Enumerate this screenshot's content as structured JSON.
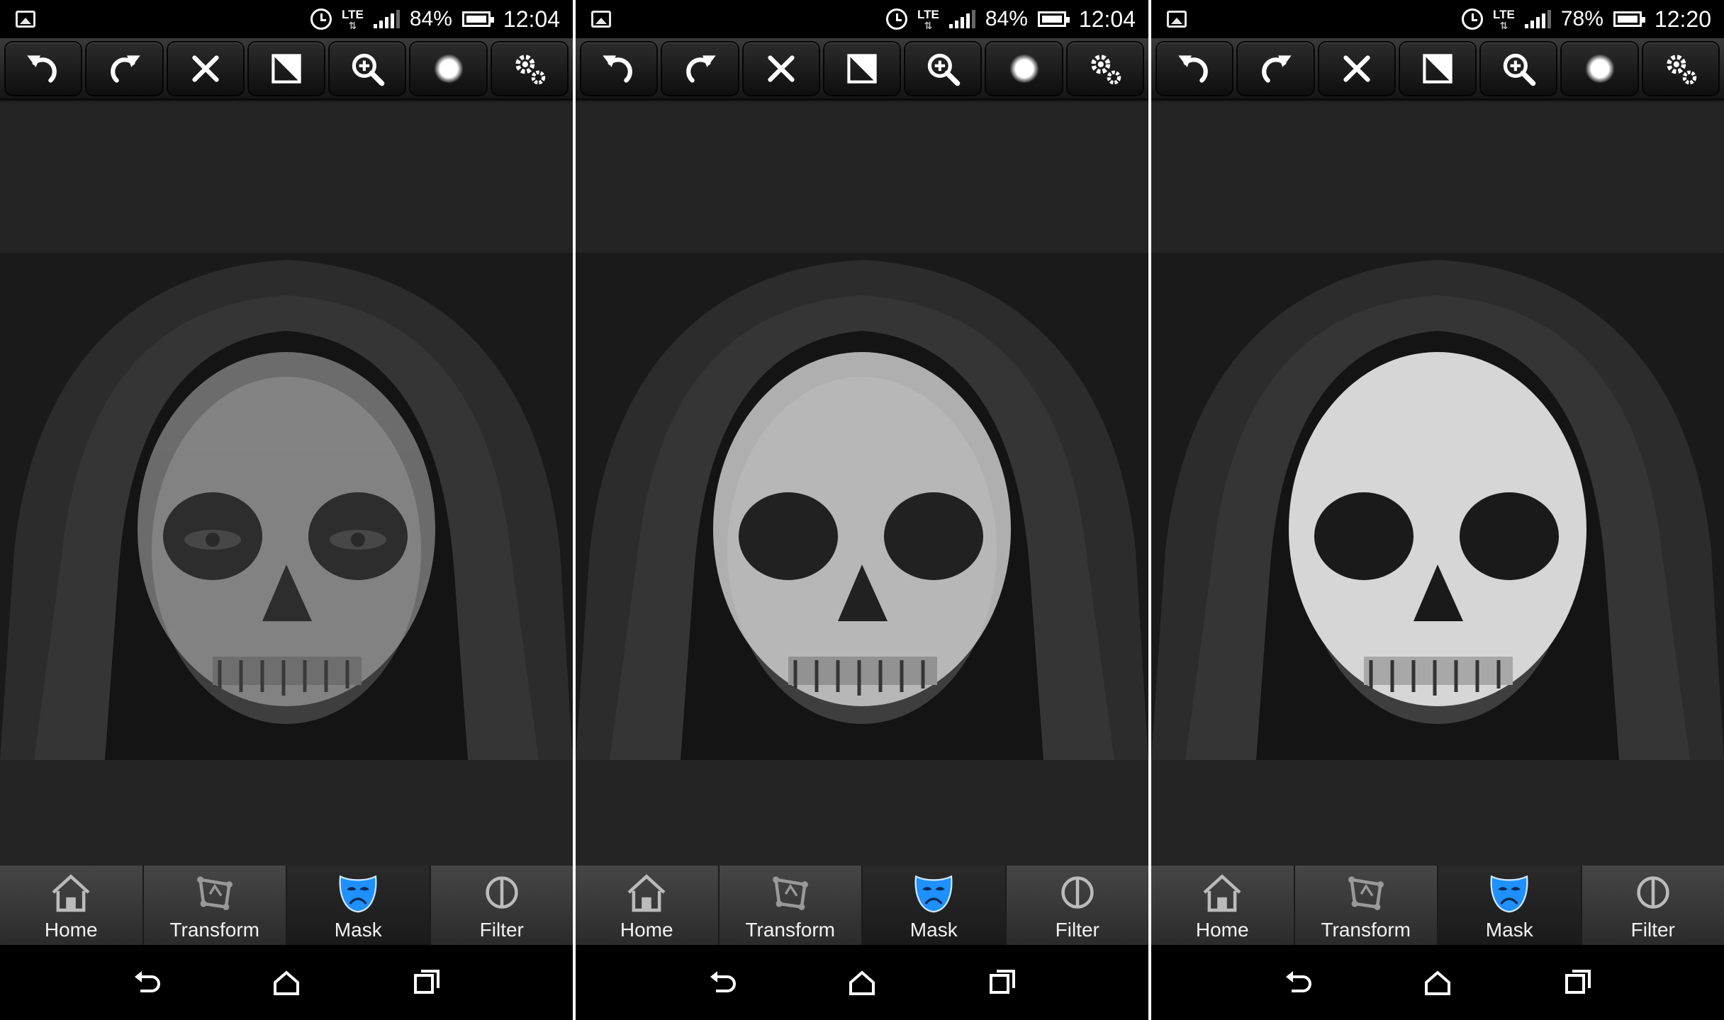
{
  "screens": [
    {
      "status": {
        "battery": "84%",
        "time": "12:04",
        "network": "LTE"
      },
      "skull_visibility": 0.45
    },
    {
      "status": {
        "battery": "84%",
        "time": "12:04",
        "network": "LTE"
      },
      "skull_visibility": 0.8
    },
    {
      "status": {
        "battery": "78%",
        "time": "12:20",
        "network": "LTE"
      },
      "skull_visibility": 1.0
    }
  ],
  "toolbar": {
    "icons": [
      "undo-icon",
      "redo-icon",
      "close-icon",
      "invert-icon",
      "zoom-icon",
      "brush-icon",
      "settings-icon"
    ]
  },
  "tabs": [
    {
      "label": "Home",
      "icon": "home-icon"
    },
    {
      "label": "Transform",
      "icon": "transform-icon"
    },
    {
      "label": "Mask",
      "icon": "mask-icon",
      "active": true
    },
    {
      "label": "Filter",
      "icon": "filter-icon"
    }
  ],
  "colors": {
    "accent": "#1e90ff",
    "background": "#242424"
  }
}
